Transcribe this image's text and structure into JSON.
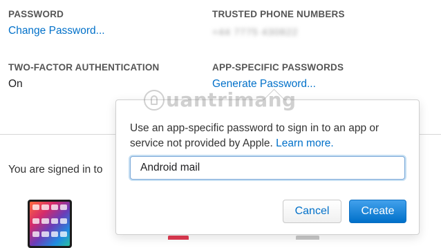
{
  "account": {
    "password_label": "PASSWORD",
    "change_password_link": "Change Password...",
    "trusted_phone_label": "TRUSTED PHONE NUMBERS",
    "trusted_phone_value": "+44 7775 430822",
    "two_factor_label": "TWO-FACTOR AUTHENTICATION",
    "two_factor_value": "On",
    "app_specific_label": "APP-SPECIFIC PASSWORDS",
    "generate_password_link": "Generate Password..."
  },
  "devices": {
    "signed_in_text": "You are signed in to"
  },
  "popover": {
    "description": "Use an app-specific password to sign in to an app or service not provided by Apple.",
    "learn_more_link": "Learn more.",
    "label_input_value": "Android mail",
    "cancel_label": "Cancel",
    "create_label": "Create"
  },
  "watermark": {
    "text": "uantrimang"
  },
  "colors": {
    "link": "#0070c9",
    "primary_button": "#0070c9",
    "label_gray": "#555555"
  }
}
